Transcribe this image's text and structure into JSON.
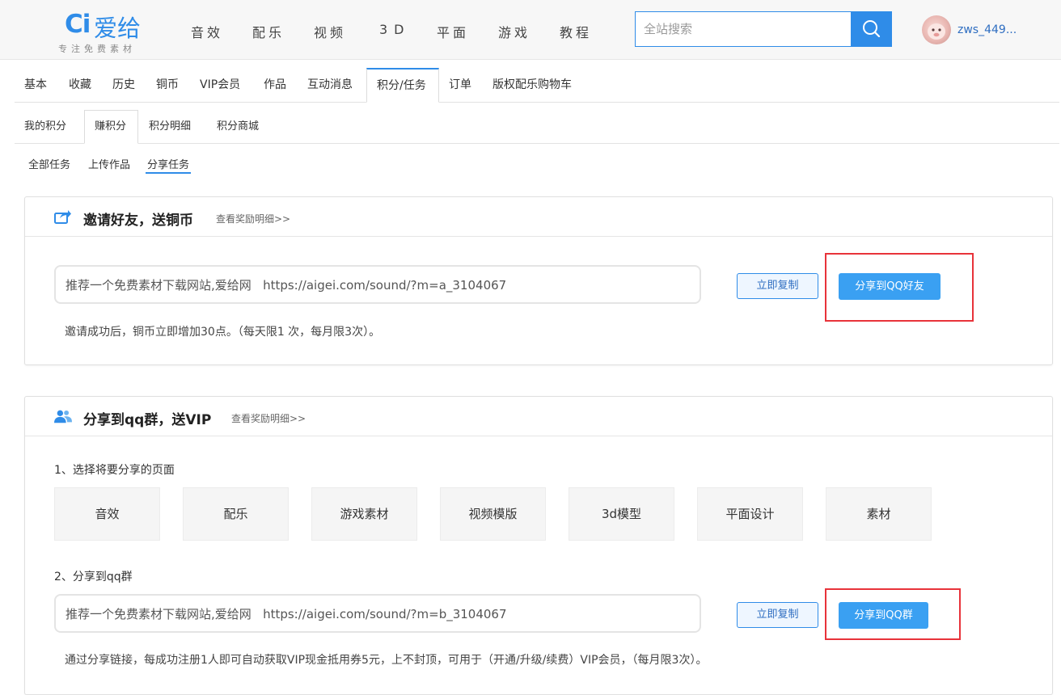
{
  "header": {
    "logo_mark": "Ci",
    "logo_name": "爱给",
    "logo_slogan": "专注免费素材",
    "nav": [
      "音效",
      "配乐",
      "视频",
      "3D",
      "平面",
      "游戏",
      "教程"
    ],
    "search_placeholder": "全站搜索",
    "search_icon": "search-icon",
    "username": "zws_449..."
  },
  "tabs_primary": {
    "items": [
      "基本",
      "收藏",
      "历史",
      "铜币",
      "VIP会员",
      "作品",
      "互动消息",
      "积分/任务",
      "订单",
      "版权配乐购物车"
    ],
    "active": "积分/任务"
  },
  "tabs_secondary": {
    "items": [
      "我的积分",
      "赚积分",
      "积分明细",
      "积分商城"
    ],
    "active": "赚积分"
  },
  "tabs_tertiary": {
    "items": [
      "全部任务",
      "上传作品",
      "分享任务"
    ],
    "active": "分享任务"
  },
  "invite_panel": {
    "icon": "share-icon",
    "title": "邀请好友，送铜币",
    "detail_link": "查看奖励明细>>",
    "link_value": "推荐一个免费素材下载网站,爱给网   https://aigei.com/sound/?m=a_3104067",
    "copy_label": "立即复制",
    "share_label": "分享到QQ好友",
    "note": "邀请成功后，铜币立即增加30点。（每天限1 次，每月限3次）。"
  },
  "group_panel": {
    "icon": "users-icon",
    "title": "分享到qq群，送VIP",
    "detail_link": "查看奖励明细>>",
    "step1": "1、选择将要分享的页面",
    "pages": [
      "音效",
      "配乐",
      "游戏素材",
      "视频模版",
      "3d模型",
      "平面设计",
      "素材"
    ],
    "step2": "2、分享到qq群",
    "link_value": "推荐一个免费素材下载网站,爱给网   https://aigei.com/sound/?m=b_3104067",
    "copy_label": "立即复制",
    "share_label": "分享到QQ群",
    "note": "通过分享链接，每成功注册1人即可自动获取VIP现金抵用券5元，上不封顶，可用于（开通/升级/续费）VIP会员，（每月限3次）。"
  },
  "colors": {
    "accent": "#2f8ce8",
    "share_button": "#3aa0f2",
    "highlight": "#e8333a"
  }
}
